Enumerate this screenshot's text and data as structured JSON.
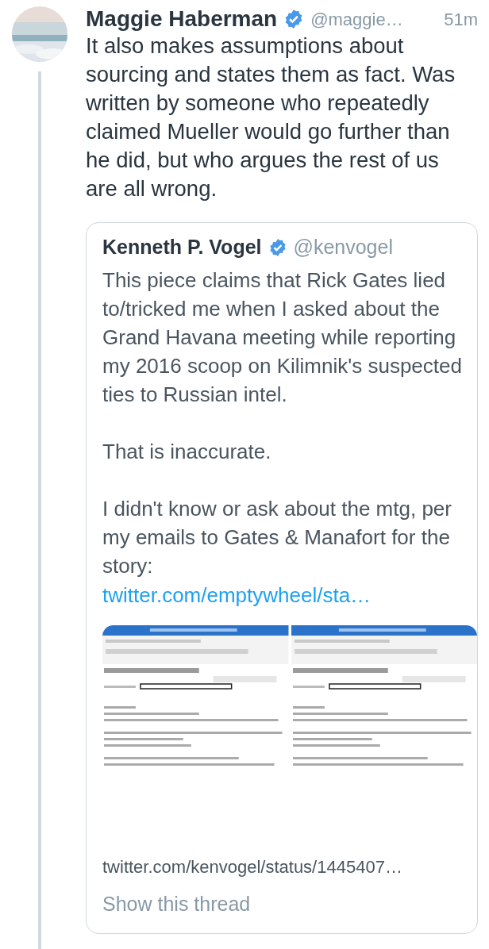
{
  "tweet": {
    "name": "Maggie Haberman",
    "verified": true,
    "handle": "@maggie…",
    "time": "51m",
    "text": "It also makes assumptions about sourcing and states them as fact. Was written by someone who repeatedly claimed Mueller would go further than he did, but who argues the rest of us are all wrong."
  },
  "quoted": {
    "name": "Kenneth P. Vogel",
    "verified": true,
    "handle": "@kenvogel",
    "paragraphs": [
      "This piece claims that Rick Gates lied to/tricked me when I asked about the Grand Havana meeting while reporting my 2016 scoop on Kilimnik's suspected ties to Russian intel.",
      "That is inaccurate.",
      "I didn't know or ask about the mtg, per my emails to Gates & Manafort for the story:"
    ],
    "link": "twitter.com/emptywheel/sta…",
    "card_link": "twitter.com/kenvogel/status/1445407…",
    "show_thread": "Show this thread"
  }
}
